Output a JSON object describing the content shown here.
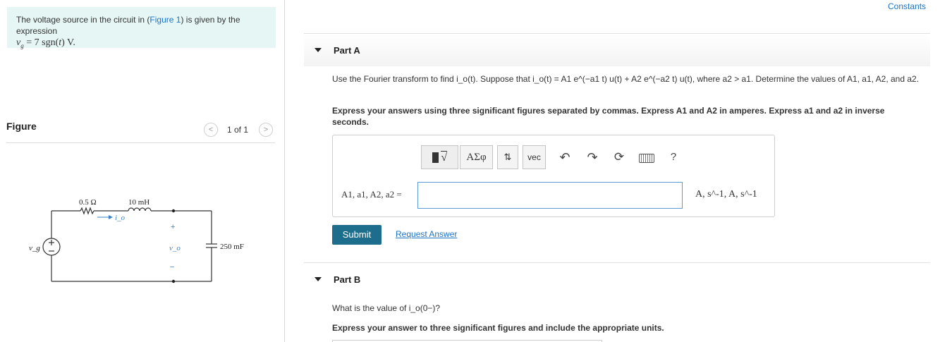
{
  "intro": {
    "text_before_link": "The voltage source in the circuit in (",
    "link": "Figure 1",
    "text_after_link": ") is given by the expression",
    "expression": "v_g = 7 sgn(t) V."
  },
  "figure": {
    "heading": "Figure",
    "pager": "1 of 1",
    "prev_icon": "chevron-left-icon",
    "next_icon": "chevron-right-icon",
    "circuit": {
      "source": "v_g",
      "resistor": "0.5 Ω",
      "inductor": "10 mH",
      "current": "i_o",
      "output": "v_o",
      "capacitor": "250 mF",
      "plus": "+",
      "minus": "−"
    }
  },
  "header": {
    "constants_link": "Constants"
  },
  "part_a": {
    "title": "Part A",
    "q1": "Use the Fourier transform to find i_o(t). Suppose that i_o(t) = A1 e^(−a1 t) u(t) + A2 e^(−a2 t) u(t), where a2 > a1. Determine the values of A1, a1, A2, and a2.",
    "q2": "Express your answers using three significant figures separated by commas. Express A1 and A2 in amperes. Express a1 and a2 in inverse seconds.",
    "toolbar": {
      "templates": "√",
      "greek": "ΑΣφ",
      "updown": "⇅",
      "vec": "vec",
      "icons": [
        "undo-icon",
        "redo-icon",
        "reset-icon",
        "keyboard-icon",
        "help-icon"
      ],
      "help": "?"
    },
    "answer_label": "A1, a1, A2, a2 =",
    "answer_value": "",
    "units": "A, s^-1, A, s^-1",
    "submit": "Submit",
    "request": "Request Answer"
  },
  "part_b": {
    "title": "Part B",
    "q1": "What is the value of i_o(0−)?",
    "q2": "Express your answer to three significant figures and include the appropriate units."
  }
}
